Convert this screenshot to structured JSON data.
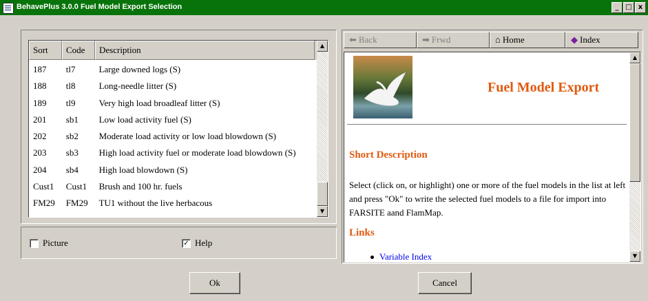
{
  "window": {
    "title": "BehavePlus 3.0.0 Fuel Model Export Selection",
    "controls": [
      "_",
      "□",
      "x"
    ]
  },
  "list": {
    "columns": [
      "Sort",
      "Code",
      "Description"
    ],
    "rows": [
      {
        "sort": "187",
        "code": "tl7",
        "description": "Large downed logs (S)"
      },
      {
        "sort": "188",
        "code": "tl8",
        "description": "Long-needle litter (S)"
      },
      {
        "sort": "189",
        "code": "tl9",
        "description": "Very high load broadleaf litter (S)"
      },
      {
        "sort": "201",
        "code": "sb1",
        "description": "Low load activity fuel (S)"
      },
      {
        "sort": "202",
        "code": "sb2",
        "description": "Moderate load activity or low load blowdown (S)"
      },
      {
        "sort": "203",
        "code": "sb3",
        "description": "High load activity fuel or moderate load blowdown (S)"
      },
      {
        "sort": "204",
        "code": "sb4",
        "description": "High load blowdown (S)"
      },
      {
        "sort": "Cust1",
        "code": "Cust1",
        "description": "Brush and 100 hr. fuels"
      },
      {
        "sort": "FM29",
        "code": "FM29",
        "description": "TU1 without the live herbacous"
      }
    ]
  },
  "options": {
    "picture": {
      "label": "Picture",
      "checked": false
    },
    "help": {
      "label": "Help",
      "checked": true
    }
  },
  "help_nav": {
    "back": "Back",
    "forward": "Frwd",
    "home": "Home",
    "index": "Index"
  },
  "help": {
    "title": "Fuel Model Export",
    "short_description_heading": "Short Description",
    "short_description": "Select (click on, or highlight) one or more of the fuel models in the list at left and press \"Ok\" to write the selected fuel models to a file for import into FARSITE aand FlamMap.",
    "links_heading": "Links",
    "link_1": "Variable Index"
  },
  "buttons": {
    "ok": "Ok",
    "cancel": "Cancel"
  },
  "colors": {
    "titlebar": "#08730a",
    "heading": "#e05a0f",
    "link": "#0000ee"
  }
}
